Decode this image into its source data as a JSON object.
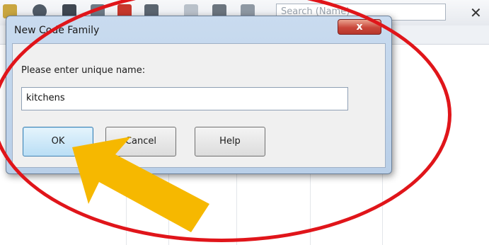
{
  "app": {
    "search_placeholder": "Search (Name)",
    "close_glyph": "✕"
  },
  "dialog": {
    "title": "New Code Family",
    "close_glyph": "x",
    "prompt": "Please enter unique name:",
    "name_value": "kitchens",
    "ok_label": "OK",
    "cancel_label": "Cancel",
    "help_label": "Help"
  },
  "annotations": {
    "ellipse_color": "#e0151a",
    "arrow_color": "#f6b800",
    "arrow_target": "ok-button"
  }
}
